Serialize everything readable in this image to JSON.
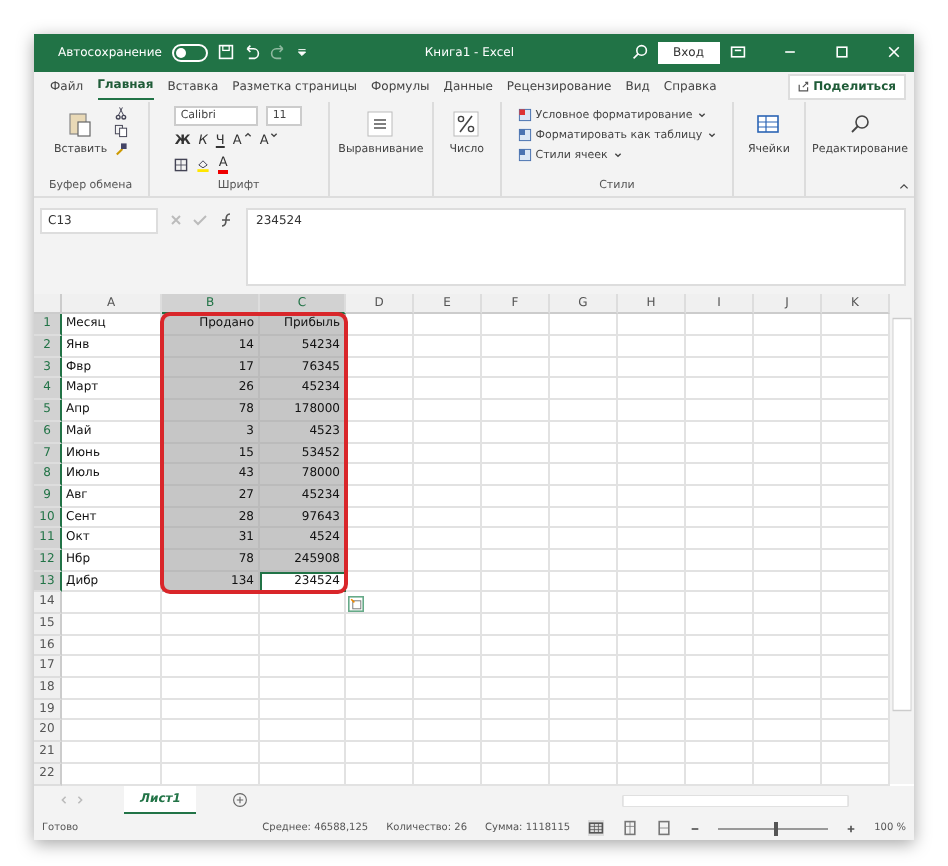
{
  "title_bar": {
    "autosave_label": "Автосохранение",
    "autosave_on": false,
    "title": "Книга1 - Excel",
    "sign_in": "Вход"
  },
  "menu_tabs": [
    {
      "label": "Файл",
      "selected": false
    },
    {
      "label": "Главная",
      "selected": true
    },
    {
      "label": "Вставка",
      "selected": false
    },
    {
      "label": "Разметка страницы",
      "selected": false
    },
    {
      "label": "Формулы",
      "selected": false
    },
    {
      "label": "Данные",
      "selected": false
    },
    {
      "label": "Рецензирование",
      "selected": false
    },
    {
      "label": "Вид",
      "selected": false
    },
    {
      "label": "Справка",
      "selected": false
    }
  ],
  "share_button": "Поделиться",
  "ribbon": {
    "clipboard": {
      "paste": "Вставить",
      "label": "Буфер обмена"
    },
    "font": {
      "family": "Calibri",
      "size": "11",
      "styles": [
        "Ж",
        "К",
        "Ч"
      ],
      "grow": "A",
      "shrink": "A",
      "color_letter": "A",
      "label": "Шрифт"
    },
    "alignment": "Выравнивание",
    "number": "Число",
    "styles": {
      "items": [
        "Условное форматирование",
        "Форматировать как таблицу",
        "Стили ячеек"
      ],
      "label": "Стили"
    },
    "cells": "Ячейки",
    "editing": "Редактирование"
  },
  "formula_bar": {
    "name_box": "C13",
    "value": "234524"
  },
  "columns": [
    {
      "letter": "A",
      "selected": false
    },
    {
      "letter": "B",
      "selected": true
    },
    {
      "letter": "C",
      "selected": true
    },
    {
      "letter": "D",
      "selected": false
    },
    {
      "letter": "E",
      "selected": false
    },
    {
      "letter": "F",
      "selected": false
    },
    {
      "letter": "G",
      "selected": false
    },
    {
      "letter": "H",
      "selected": false
    },
    {
      "letter": "I",
      "selected": false
    },
    {
      "letter": "J",
      "selected": false
    },
    {
      "letter": "K",
      "selected": false
    }
  ],
  "rows": [
    {
      "number": "1",
      "selected": true,
      "cells": [
        {
          "text": "Месяц",
          "active": false
        },
        {
          "text": "Продано",
          "active": false
        },
        {
          "text": "Прибыль",
          "active": false
        }
      ]
    },
    {
      "number": "2",
      "selected": true,
      "cells": [
        {
          "text": "Янв",
          "active": false
        },
        {
          "text": "14",
          "active": false
        },
        {
          "text": "54234",
          "active": false
        }
      ]
    },
    {
      "number": "3",
      "selected": true,
      "cells": [
        {
          "text": "Фвр",
          "active": false
        },
        {
          "text": "17",
          "active": false
        },
        {
          "text": "76345",
          "active": false
        }
      ]
    },
    {
      "number": "4",
      "selected": true,
      "cells": [
        {
          "text": "Март",
          "active": false
        },
        {
          "text": "26",
          "active": false
        },
        {
          "text": "45234",
          "active": false
        }
      ]
    },
    {
      "number": "5",
      "selected": true,
      "cells": [
        {
          "text": "Апр",
          "active": false
        },
        {
          "text": "78",
          "active": false
        },
        {
          "text": "178000",
          "active": false
        }
      ]
    },
    {
      "number": "6",
      "selected": true,
      "cells": [
        {
          "text": "Май",
          "active": false
        },
        {
          "text": "3",
          "active": false
        },
        {
          "text": "4523",
          "active": false
        }
      ]
    },
    {
      "number": "7",
      "selected": true,
      "cells": [
        {
          "text": "Июнь",
          "active": false
        },
        {
          "text": "15",
          "active": false
        },
        {
          "text": "53452",
          "active": false
        }
      ]
    },
    {
      "number": "8",
      "selected": true,
      "cells": [
        {
          "text": "Июль",
          "active": false
        },
        {
          "text": "43",
          "active": false
        },
        {
          "text": "78000",
          "active": false
        }
      ]
    },
    {
      "number": "9",
      "selected": true,
      "cells": [
        {
          "text": "Авг",
          "active": false
        },
        {
          "text": "27",
          "active": false
        },
        {
          "text": "45234",
          "active": false
        }
      ]
    },
    {
      "number": "10",
      "selected": true,
      "cells": [
        {
          "text": "Сент",
          "active": false
        },
        {
          "text": "28",
          "active": false
        },
        {
          "text": "97643",
          "active": false
        }
      ]
    },
    {
      "number": "11",
      "selected": true,
      "cells": [
        {
          "text": "Окт",
          "active": false
        },
        {
          "text": "31",
          "active": false
        },
        {
          "text": "4524",
          "active": false
        }
      ]
    },
    {
      "number": "12",
      "selected": true,
      "cells": [
        {
          "text": "Нбр",
          "active": false
        },
        {
          "text": "78",
          "active": false
        },
        {
          "text": "245908",
          "active": false
        }
      ]
    },
    {
      "number": "13",
      "selected": true,
      "cells": [
        {
          "text": "Дибр",
          "active": false
        },
        {
          "text": "134",
          "active": false
        },
        {
          "text": "234524",
          "active": true
        }
      ]
    },
    {
      "number": "14",
      "selected": false
    },
    {
      "number": "15",
      "selected": false
    },
    {
      "number": "16",
      "selected": false
    },
    {
      "number": "17",
      "selected": false
    },
    {
      "number": "18",
      "selected": false
    },
    {
      "number": "19",
      "selected": false
    },
    {
      "number": "20",
      "selected": false
    },
    {
      "number": "21",
      "selected": false
    },
    {
      "number": "22",
      "selected": false
    }
  ],
  "sheet_tabs": [
    {
      "label": "Лист1",
      "selected": true
    }
  ],
  "status_bar": {
    "state": "Готово",
    "average": "Среднее: 46588,125",
    "count": "Количество: 26",
    "sum": "Сумма: 1118115",
    "zoom": {
      "level": 0.5,
      "reading": "100 %"
    }
  }
}
